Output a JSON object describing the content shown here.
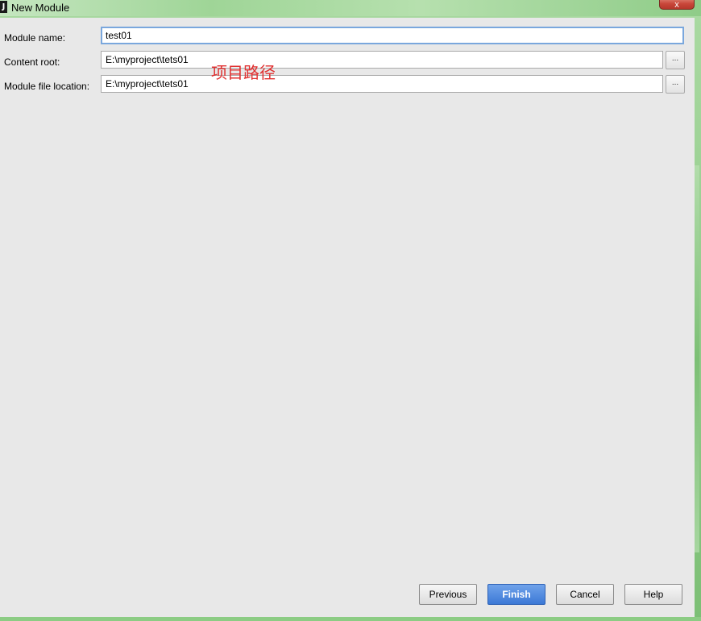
{
  "window": {
    "title": "New Module",
    "icon_letter": "J",
    "close_glyph": "x"
  },
  "form": {
    "module_name_label": "Module name:",
    "module_name_value": "test01",
    "content_root_label": "Content root:",
    "content_root_value": "E:\\myproject\\tets01",
    "module_file_label": "Module file location:",
    "module_file_value": "E:\\myproject\\tets01",
    "browse_label": "..."
  },
  "annotation": "项目路径",
  "buttons": {
    "previous": "Previous",
    "finish": "Finish",
    "cancel": "Cancel",
    "help": "Help"
  }
}
